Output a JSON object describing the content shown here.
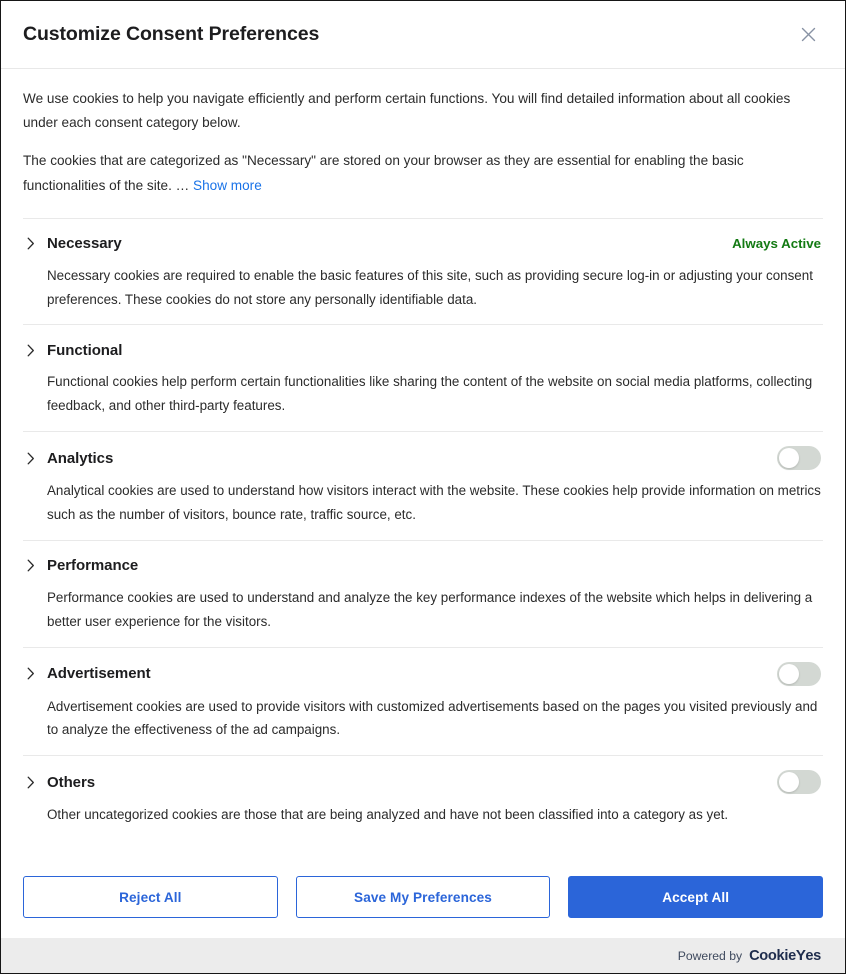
{
  "header": {
    "title": "Customize Consent Preferences",
    "close_icon": "close-icon"
  },
  "intro": {
    "paragraph1": "We use cookies to help you navigate efficiently and perform certain functions. You will find detailed information about all cookies under each consent category below.",
    "paragraph2": "The cookies that are categorized as \"Necessary\" are stored on your browser as they are essential for enabling the basic functionalities of the site. ",
    "ellipsis": "… ",
    "show_more_label": "Show more"
  },
  "categories": [
    {
      "name": "Necessary",
      "description": "Necessary cookies are required to enable the basic features of this site, such as providing secure log-in or adjusting your consent preferences. These cookies do not store any personally identifiable data.",
      "control": "always-active",
      "status_label": "Always Active",
      "expanded": false,
      "chevron_icon": "chevron-right-icon"
    },
    {
      "name": "Functional",
      "description": "Functional cookies help perform certain functionalities like sharing the content of the website on social media platforms, collecting feedback, and other third-party features.",
      "control": "none",
      "status_label": "",
      "expanded": false,
      "chevron_icon": "chevron-right-icon"
    },
    {
      "name": "Analytics",
      "description": "Analytical cookies are used to understand how visitors interact with the website. These cookies help provide information on metrics such as the number of visitors, bounce rate, traffic source, etc.",
      "control": "toggle",
      "toggle_on": false,
      "status_label": "",
      "expanded": false,
      "chevron_icon": "chevron-right-icon"
    },
    {
      "name": "Performance",
      "description": "Performance cookies are used to understand and analyze the key performance indexes of the website which helps in delivering a better user experience for the visitors.",
      "control": "none",
      "status_label": "",
      "expanded": false,
      "chevron_icon": "chevron-right-icon"
    },
    {
      "name": "Advertisement",
      "description": "Advertisement cookies are used to provide visitors with customized advertisements based on the pages you visited previously and to analyze the effectiveness of the ad campaigns.",
      "control": "toggle",
      "toggle_on": false,
      "status_label": "",
      "expanded": false,
      "chevron_icon": "chevron-right-icon"
    },
    {
      "name": "Others",
      "description": "Other uncategorized cookies are those that are being analyzed and have not been classified into a category as yet.",
      "control": "toggle",
      "toggle_on": false,
      "status_label": "",
      "expanded": false,
      "chevron_icon": "chevron-right-icon"
    }
  ],
  "actions": {
    "reject_all": "Reject All",
    "save_preferences": "Save My Preferences",
    "accept_all": "Accept All"
  },
  "footer": {
    "powered_by": "Powered by",
    "brand_part1": "Cookie",
    "brand_part2": "Y",
    "brand_part3": "es"
  },
  "colors": {
    "accent_blue": "#2b65d9",
    "link_blue": "#1a73e8",
    "always_active_green": "#137a13",
    "toggle_off_track": "#d3d8d3",
    "footer_band": "#ececec",
    "text_primary": "#1d1d1f",
    "text_body": "#2b2b2b",
    "divider": "#e9e9e9"
  }
}
